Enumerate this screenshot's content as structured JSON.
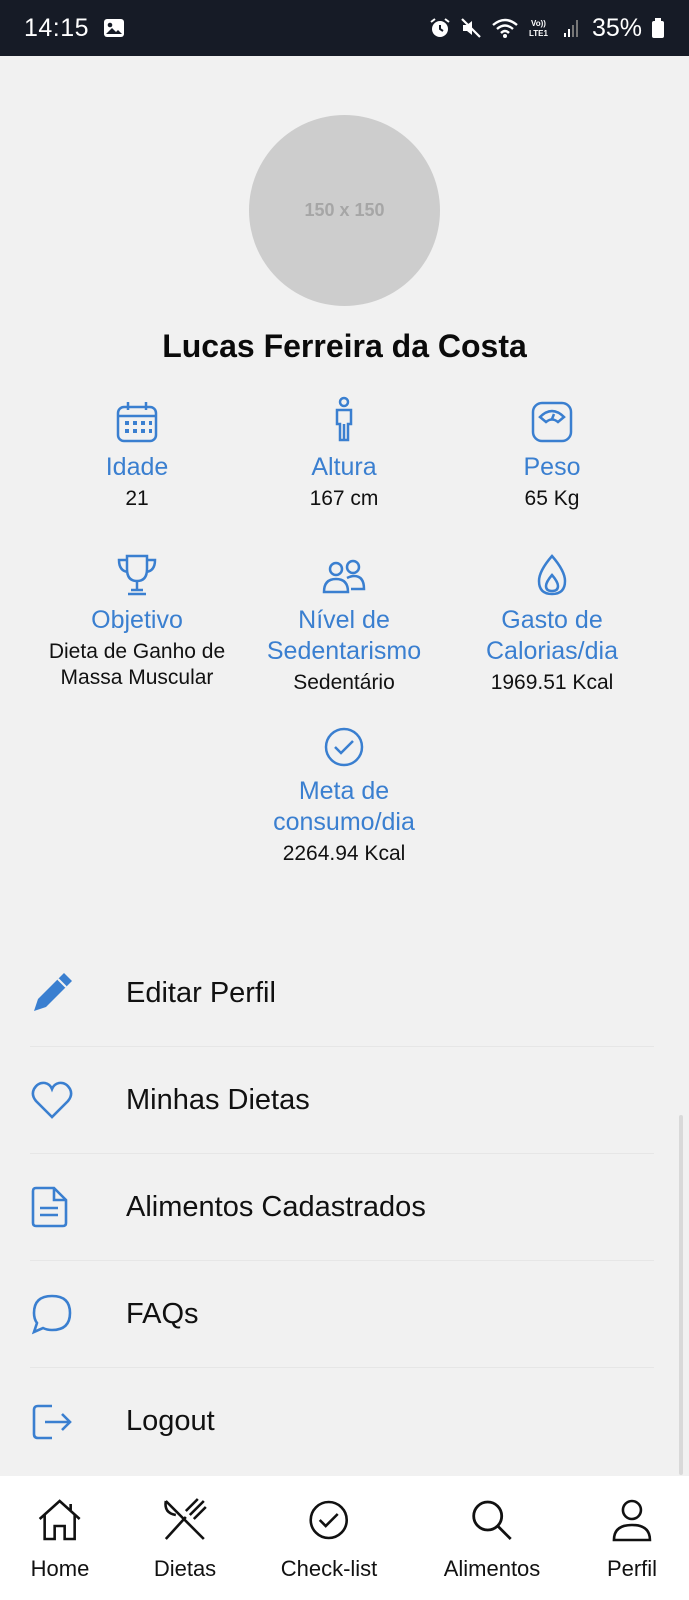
{
  "status_bar": {
    "time": "14:15",
    "battery": "35%"
  },
  "profile": {
    "avatar_placeholder": "150 x 150",
    "name": "Lucas Ferreira da Costa"
  },
  "stats": {
    "idade": {
      "label": "Idade",
      "value": "21",
      "icon": "calendar-icon"
    },
    "altura": {
      "label": "Altura",
      "value": "167 cm",
      "icon": "person-height-icon"
    },
    "peso": {
      "label": "Peso",
      "value": "65 Kg",
      "icon": "scale-icon"
    },
    "objetivo": {
      "label": "Objetivo",
      "value_line1": "Dieta de Ganho de",
      "value_line2": "Massa Muscular",
      "icon": "trophy-icon"
    },
    "sedentarismo": {
      "label_line1": "Nível de",
      "label_line2": "Sedentarismo",
      "value": "Sedentário",
      "icon": "people-icon"
    },
    "gasto": {
      "label_line1": "Gasto de",
      "label_line2": "Calorias/dia",
      "value": "1969.51 Kcal",
      "icon": "flame-icon"
    },
    "meta": {
      "label_line1": "Meta de",
      "label_line2": "consumo/dia",
      "value": "2264.94 Kcal",
      "icon": "check-circle-icon"
    }
  },
  "menu": {
    "items": [
      {
        "label": "Editar Perfil",
        "icon": "pencil-icon"
      },
      {
        "label": "Minhas Dietas",
        "icon": "heart-icon"
      },
      {
        "label": "Alimentos Cadastrados",
        "icon": "document-icon"
      },
      {
        "label": "FAQs",
        "icon": "chat-bubble-icon"
      },
      {
        "label": "Logout",
        "icon": "logout-icon"
      }
    ]
  },
  "bottom_nav": {
    "items": [
      {
        "label": "Home",
        "icon": "home-icon"
      },
      {
        "label": "Dietas",
        "icon": "fork-knife-icon"
      },
      {
        "label": "Check-list",
        "icon": "check-circle-icon"
      },
      {
        "label": "Alimentos",
        "icon": "search-icon"
      },
      {
        "label": "Perfil",
        "icon": "user-icon"
      }
    ]
  },
  "colors": {
    "accent": "#3a7fd0",
    "status_bar_bg": "#161b26",
    "background": "#f1f1f1",
    "avatar_bg": "#cdcdcd"
  }
}
